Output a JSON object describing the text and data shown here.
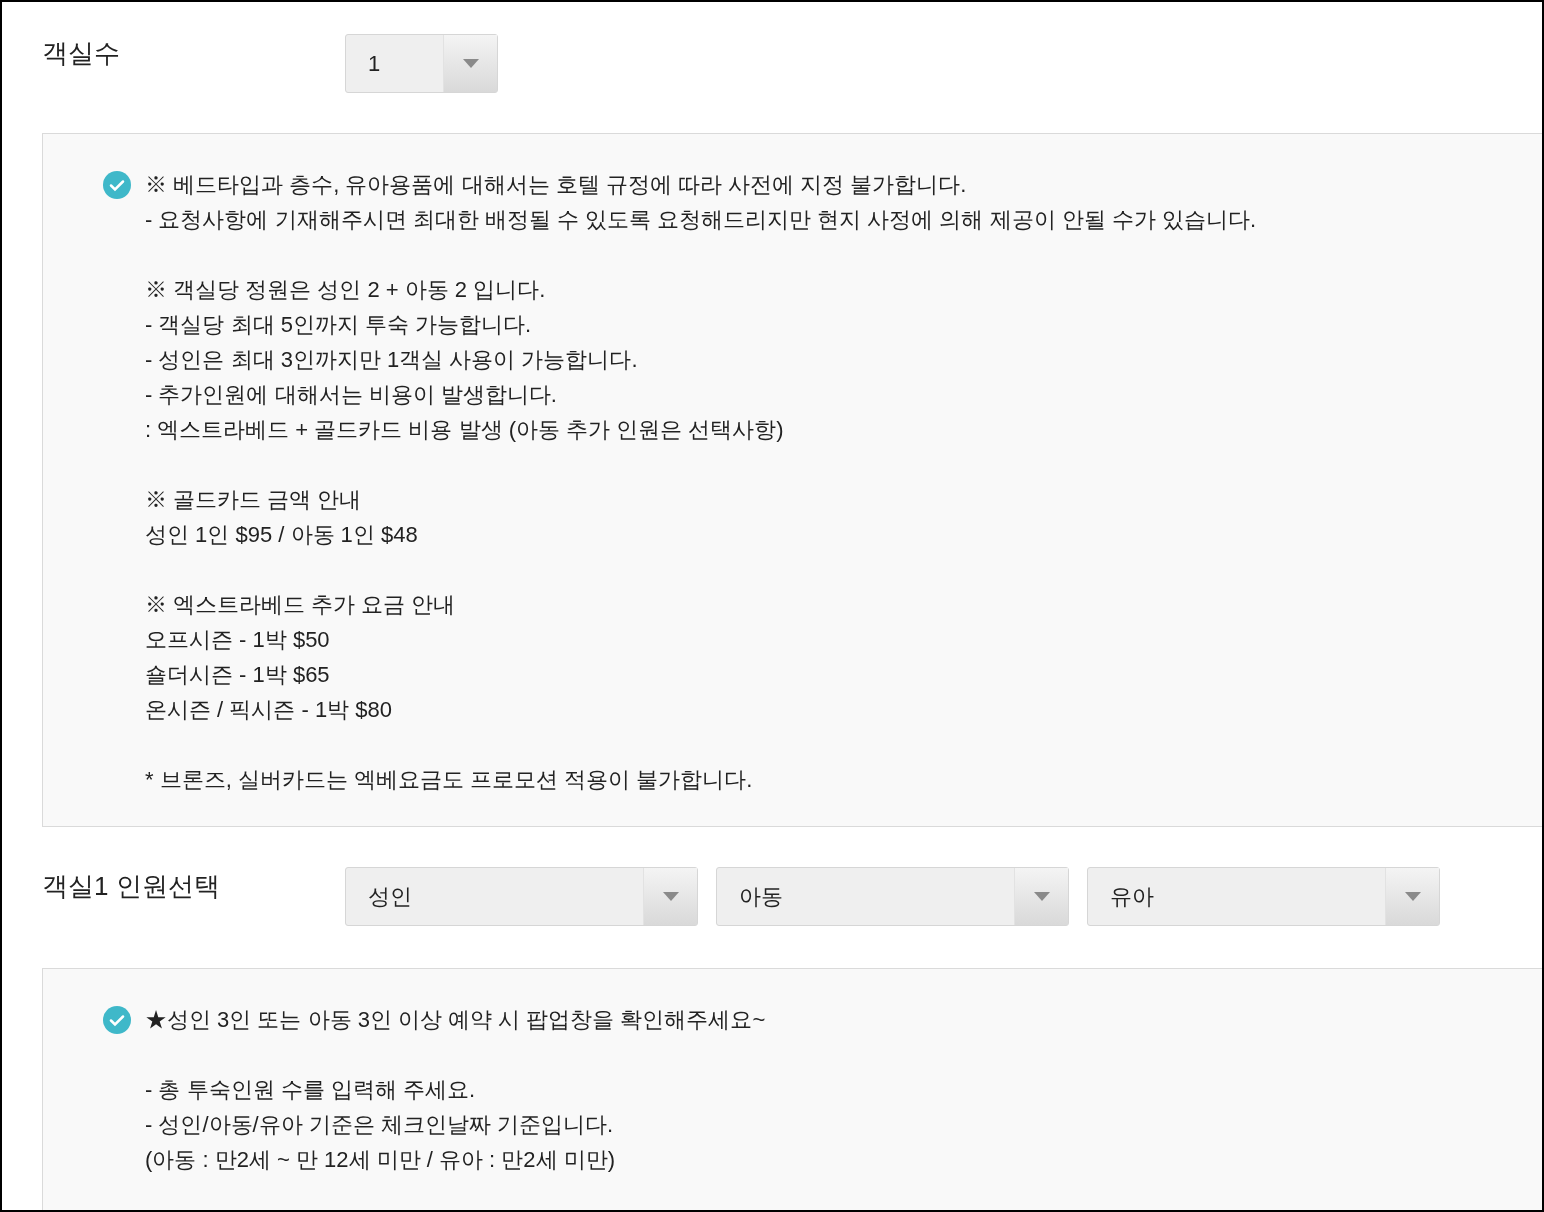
{
  "rooms": {
    "label": "객실수",
    "select": {
      "value": "1"
    }
  },
  "notice_1": {
    "paragraphs": [
      [
        "※ 베드타입과 층수, 유아용품에 대해서는 호텔 규정에 따라 사전에 지정 불가합니다.",
        "- 요청사항에 기재해주시면 최대한 배정될 수 있도록 요청해드리지만 현지 사정에 의해 제공이 안될 수가 있습니다."
      ],
      [
        "※ 객실당 정원은 성인 2 + 아동 2 입니다.",
        "- 객실당 최대 5인까지 투숙 가능합니다.",
        "- 성인은 최대 3인까지만 1객실 사용이 가능합니다.",
        "- 추가인원에 대해서는 비용이 발생합니다.",
        ": 엑스트라베드 + 골드카드 비용 발생 (아동 추가 인원은 선택사항)"
      ],
      [
        "※ 골드카드 금액 안내",
        "성인 1인 $95 / 아동 1인 $48"
      ],
      [
        "※ 엑스트라베드 추가 요금 안내",
        "오프시즌 - 1박 $50",
        "숄더시즌 - 1박 $65",
        "온시즌 / 픽시즌 - 1박 $80"
      ],
      [
        "* 브론즈, 실버카드는 엑베요금도 프로모션 적용이 불가합니다."
      ]
    ]
  },
  "guests": {
    "label": "객실1 인원선택",
    "selects": [
      {
        "value": "성인"
      },
      {
        "value": "아동"
      },
      {
        "value": "유아"
      }
    ]
  },
  "notice_2": {
    "paragraphs": [
      [
        "★성인 3인 또는 아동 3인 이상 예약 시 팝업창을 확인해주세요~"
      ],
      [
        "- 총 투숙인원 수를 입력해 주세요.",
        "- 성인/아동/유아 기준은 체크인날짜 기준입니다.",
        "(아동 : 만2세 ~ 만 12세 미만 / 유아 : 만2세 미만)"
      ]
    ]
  }
}
